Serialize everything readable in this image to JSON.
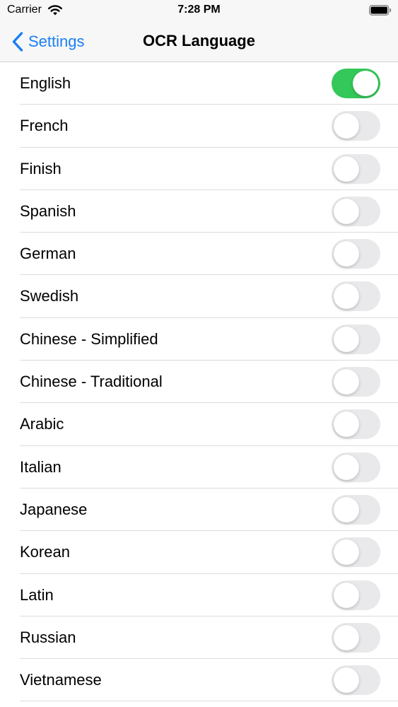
{
  "status_bar": {
    "carrier": "Carrier",
    "time": "7:28 PM",
    "icons": [
      "wifi-icon",
      "battery-icon"
    ]
  },
  "nav_bar": {
    "back_label": "Settings",
    "back_icon": "chevron-left-icon",
    "title": "OCR Language"
  },
  "colors": {
    "accent": "#1a7ef5",
    "toggle_on": "#34c759",
    "toggle_off": "#e9e9eb"
  },
  "languages": [
    {
      "label": "English",
      "enabled": true
    },
    {
      "label": "French",
      "enabled": false
    },
    {
      "label": "Finish",
      "enabled": false
    },
    {
      "label": "Spanish",
      "enabled": false
    },
    {
      "label": "German",
      "enabled": false
    },
    {
      "label": "Swedish",
      "enabled": false
    },
    {
      "label": "Chinese - Simplified",
      "enabled": false
    },
    {
      "label": "Chinese - Traditional",
      "enabled": false
    },
    {
      "label": "Arabic",
      "enabled": false
    },
    {
      "label": "Italian",
      "enabled": false
    },
    {
      "label": "Japanese",
      "enabled": false
    },
    {
      "label": "Korean",
      "enabled": false
    },
    {
      "label": "Latin",
      "enabled": false
    },
    {
      "label": "Russian",
      "enabled": false
    },
    {
      "label": "Vietnamese",
      "enabled": false
    }
  ]
}
